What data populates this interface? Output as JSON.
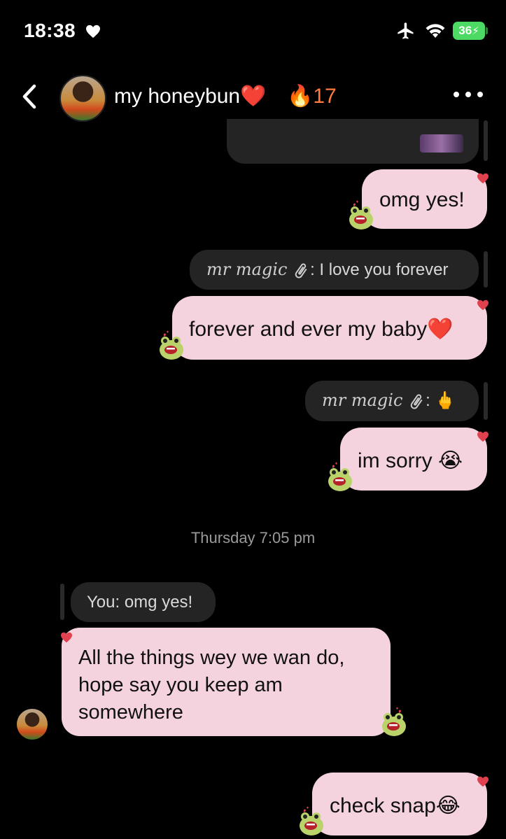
{
  "status_bar": {
    "time": "18:38",
    "battery": "36"
  },
  "header": {
    "contact_name": "my honeybun❤️",
    "streak": "🔥17"
  },
  "messages": [
    {
      "text": "omg yes!"
    },
    {
      "reply_sender": "mr magic",
      "reply_text": ": I love you forever"
    },
    {
      "text": "forever and ever my baby❤️"
    },
    {
      "reply_sender": "mr magic",
      "reply_text": ": 🖕"
    },
    {
      "text": "im sorry 😭"
    },
    {
      "timestamp": "Thursday 7:05 pm"
    },
    {
      "reply_text": "You: omg yes!"
    },
    {
      "text": "All the things wey we wan do, hope say you keep am somewhere"
    },
    {
      "text": "check snap😂"
    }
  ],
  "colors": {
    "bubble": "#f4d3df",
    "dark_bubble": "#242424",
    "heart": "#e0414e",
    "streak": "#ff7a3c",
    "battery": "#4cd964"
  },
  "icons": [
    "heart-icon",
    "airplane-icon",
    "wifi-icon",
    "battery-icon",
    "back-icon",
    "more-icon",
    "paperclip-icon",
    "frog-sticker"
  ]
}
